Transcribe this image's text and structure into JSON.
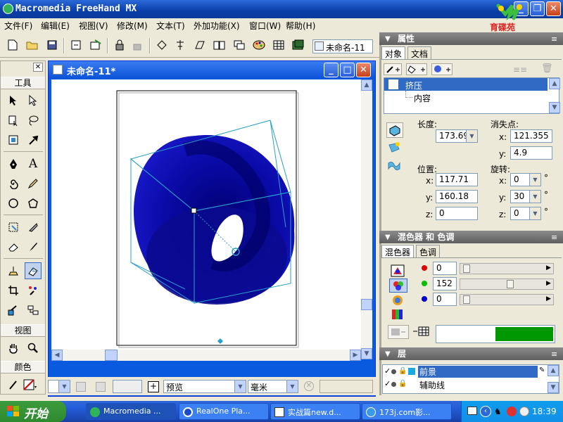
{
  "app": {
    "title": "Macromedia FreeHand MX",
    "logo_text": "育碟苑"
  },
  "menu": [
    "文件(F)",
    "编辑(E)",
    "视图(V)",
    "修改(M)",
    "文本(T)",
    "外加功能(X)",
    "窗口(W)",
    "帮助(H)"
  ],
  "toolbar": {
    "doc_name": "未命名-11"
  },
  "tools_panel": {
    "header": "工具",
    "view_header": "视图",
    "color_header": "颜色"
  },
  "document": {
    "title": "未命名-11*"
  },
  "statusbar": {
    "view_mode": "预览",
    "units": "毫米"
  },
  "properties": {
    "header": "属性",
    "tabs": [
      "对象",
      "文档"
    ],
    "tree": [
      "挤压",
      "内容"
    ],
    "length_label": "长度:",
    "length_value": "173.69",
    "vanish_label": "消失点:",
    "vx_label": "x:",
    "vx_value": "121.355",
    "vy_label": "y:",
    "vy_value": "4.9",
    "pos_label": "位置:",
    "px_label": "x:",
    "px_value": "117.71",
    "py_label": "y:",
    "py_value": "160.18",
    "pz_label": "z:",
    "pz_value": "0",
    "rot_label": "旋转:",
    "rx_label": "x:",
    "rx_value": "0",
    "ry_label": "y:",
    "ry_value": "30",
    "rz_label": "z:",
    "rz_value": "0",
    "degree": "°"
  },
  "mixer": {
    "header": "混色器 和 色调",
    "tabs": [
      "混色器",
      "色调"
    ],
    "r": "0",
    "g": "152",
    "b": "0",
    "swatch_color": "#009800"
  },
  "layers": {
    "header": "层",
    "items": [
      "前景",
      "辅助线"
    ]
  },
  "taskbar": {
    "start": "开始",
    "tasks": [
      "Macromedia ...",
      "RealOne Pla...",
      "实战篇new.d...",
      "173j.com影..."
    ],
    "clock": "18:39"
  },
  "colors": {
    "object": "#1414c8",
    "accent": "#316ac5"
  }
}
